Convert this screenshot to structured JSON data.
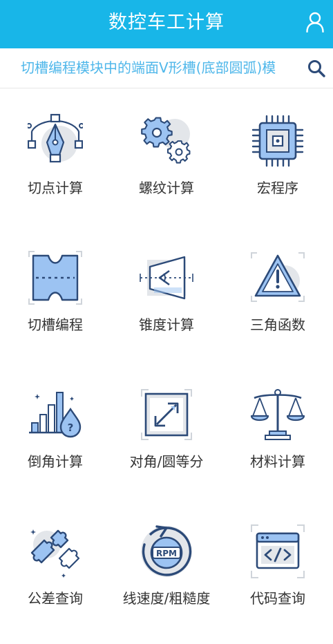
{
  "header": {
    "title": "数控车工计算",
    "user_icon": "user-icon"
  },
  "marquee": {
    "text": "切槽编程模块中的端面V形槽(底部圆弧)模",
    "search_icon": "search-icon"
  },
  "grid": {
    "items": [
      {
        "label": "切点计算",
        "icon": "pen-tool-icon"
      },
      {
        "label": "螺纹计算",
        "icon": "gears-icon"
      },
      {
        "label": "宏程序",
        "icon": "chip-icon"
      },
      {
        "label": "切槽编程",
        "icon": "groove-icon"
      },
      {
        "label": "锥度计算",
        "icon": "taper-icon"
      },
      {
        "label": "三角函数",
        "icon": "warning-triangle-icon"
      },
      {
        "label": "倒角计算",
        "icon": "chart-drop-icon"
      },
      {
        "label": "对角/圆等分",
        "icon": "diagonal-resize-icon"
      },
      {
        "label": "材料计算",
        "icon": "scale-icon"
      },
      {
        "label": "公差查询",
        "icon": "puzzle-icon"
      },
      {
        "label": "线速度/粗糙度",
        "icon": "rpm-icon"
      },
      {
        "label": "代码查询",
        "icon": "code-window-icon"
      }
    ]
  },
  "colors": {
    "header_bg": "#18b6e8",
    "marquee_text": "#4fb7ea",
    "icon_stroke": "#2c4a78",
    "icon_fill": "#9cc3f2",
    "icon_shadow": "#e3e6ea"
  }
}
